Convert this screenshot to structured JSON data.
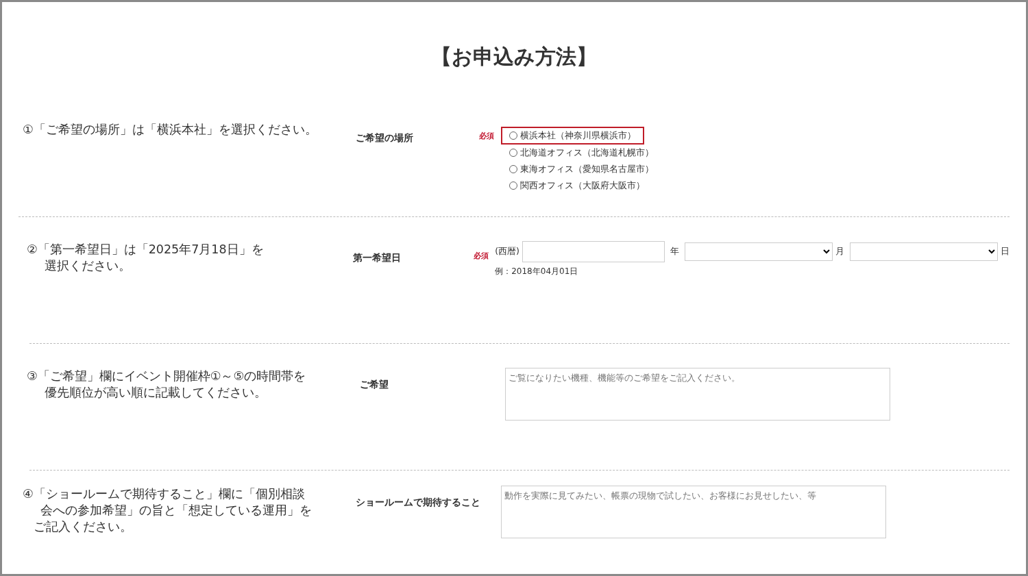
{
  "title": "【お申込み方法】",
  "sections": [
    {
      "kind": "radio",
      "instruction_lines": [
        "①「ご希望の場所」は「横浜本社」を選択ください。"
      ],
      "label": "ご希望の場所",
      "required_text": "必須",
      "options": [
        {
          "label": "横浜本社（神奈川県横浜市）",
          "selected": false,
          "highlighted": true
        },
        {
          "label": "北海道オフィス（北海道札幌市）",
          "selected": false,
          "highlighted": false
        },
        {
          "label": "東海オフィス（愛知県名古屋市）",
          "selected": false,
          "highlighted": false
        },
        {
          "label": "関西オフィス（大阪府大阪市）",
          "selected": false,
          "highlighted": false
        }
      ]
    },
    {
      "kind": "date",
      "instruction_lines": [
        "②「第一希望日」は「2025年7月18日」を",
        "選択ください。"
      ],
      "label": "第一希望日",
      "required_text": "必須",
      "era": "(西暦)",
      "year_unit": "年",
      "month_unit": "月",
      "day_unit": "日",
      "hint": "例：2018年04月01日"
    },
    {
      "kind": "textarea",
      "instruction_lines": [
        "③「ご希望」欄にイベント開催枠①～⑤の時間帯を",
        "優先順位が高い順に記載してください。"
      ],
      "label": "ご希望",
      "placeholder": "ご覧になりたい機種、機能等のご希望をご記入ください。"
    },
    {
      "kind": "textarea",
      "instruction_lines": [
        "④「ショールームで期待すること」欄に「個別相談",
        "会への参加希望」の旨と「想定している運用」を",
        "ご記入ください。"
      ],
      "label": "ショールームで期待すること",
      "placeholder": "動作を実際に見てみたい、帳票の現物で試したい、お客様にお見せしたい、等"
    }
  ]
}
